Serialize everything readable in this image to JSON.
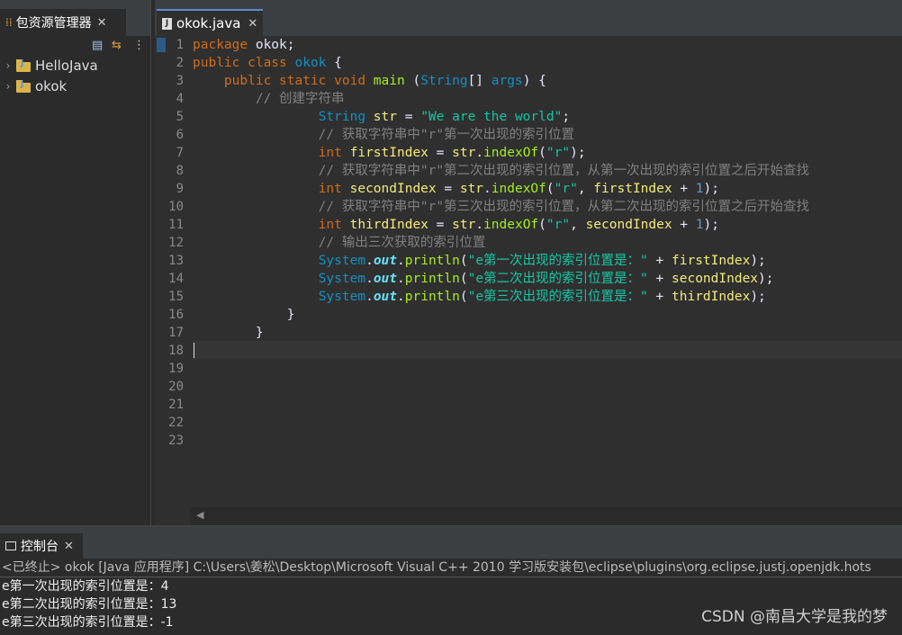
{
  "package_explorer": {
    "tab_label": "包资源管理器",
    "close_glyph": "✕",
    "items": [
      {
        "label": "HelloJava",
        "expanded": false
      },
      {
        "label": "okok",
        "expanded": false
      }
    ]
  },
  "editor": {
    "tab_label": "okok.java",
    "close_glyph": "✕",
    "line_numbers": [
      "1",
      "2",
      "3",
      "4",
      "5",
      "6",
      "7",
      "8",
      "9",
      "10",
      "11",
      "12",
      "13",
      "14",
      "15",
      "16",
      "17",
      "18",
      "19",
      "20",
      "21",
      "22",
      "23"
    ],
    "code_lines": [
      [
        {
          "t": "package ",
          "c": "kw"
        },
        {
          "t": "okok;",
          "c": "op"
        }
      ],
      [
        {
          "t": "public ",
          "c": "kw"
        },
        {
          "t": "class ",
          "c": "kw"
        },
        {
          "t": "okok ",
          "c": "ty"
        },
        {
          "t": "{",
          "c": "op"
        }
      ],
      [
        {
          "t": "    public ",
          "c": "kw"
        },
        {
          "t": "static ",
          "c": "kw"
        },
        {
          "t": "void ",
          "c": "kw"
        },
        {
          "t": "main ",
          "c": "mth"
        },
        {
          "t": "(",
          "c": "op"
        },
        {
          "t": "String",
          "c": "ty"
        },
        {
          "t": "[] ",
          "c": "op"
        },
        {
          "t": "args",
          "c": "ty"
        },
        {
          "t": ") {",
          "c": "op"
        }
      ],
      [
        {
          "t": "        // 创建字符串",
          "c": "cm"
        }
      ],
      [
        {
          "t": "                ",
          "c": "op"
        },
        {
          "t": "String ",
          "c": "ty"
        },
        {
          "t": "str ",
          "c": "var"
        },
        {
          "t": "= ",
          "c": "op"
        },
        {
          "t": "\"We are the world\"",
          "c": "str"
        },
        {
          "t": ";",
          "c": "op"
        }
      ],
      [
        {
          "t": "                // 获取字符串中\"r\"第一次出现的索引位置",
          "c": "cm"
        }
      ],
      [
        {
          "t": "                ",
          "c": "op"
        },
        {
          "t": "int ",
          "c": "kw"
        },
        {
          "t": "firstIndex ",
          "c": "var"
        },
        {
          "t": "= ",
          "c": "op"
        },
        {
          "t": "str",
          "c": "var"
        },
        {
          "t": ".",
          "c": "op"
        },
        {
          "t": "indexOf",
          "c": "mth"
        },
        {
          "t": "(",
          "c": "op"
        },
        {
          "t": "\"r\"",
          "c": "str"
        },
        {
          "t": ");",
          "c": "op"
        }
      ],
      [
        {
          "t": "                // 获取字符串中\"r\"第二次出现的索引位置，从第一次出现的索引位置之后开始查找",
          "c": "cm"
        }
      ],
      [
        {
          "t": "                ",
          "c": "op"
        },
        {
          "t": "int ",
          "c": "kw"
        },
        {
          "t": "secondIndex ",
          "c": "var"
        },
        {
          "t": "= ",
          "c": "op"
        },
        {
          "t": "str",
          "c": "var"
        },
        {
          "t": ".",
          "c": "op"
        },
        {
          "t": "indexOf",
          "c": "mth"
        },
        {
          "t": "(",
          "c": "op"
        },
        {
          "t": "\"r\"",
          "c": "str"
        },
        {
          "t": ", ",
          "c": "op"
        },
        {
          "t": "firstIndex ",
          "c": "var"
        },
        {
          "t": "+ ",
          "c": "op"
        },
        {
          "t": "1",
          "c": "num"
        },
        {
          "t": ");",
          "c": "op"
        }
      ],
      [
        {
          "t": "                // 获取字符串中\"r\"第三次出现的索引位置，从第二次出现的索引位置之后开始查找",
          "c": "cm"
        }
      ],
      [
        {
          "t": "                ",
          "c": "op"
        },
        {
          "t": "int ",
          "c": "kw"
        },
        {
          "t": "thirdIndex ",
          "c": "var"
        },
        {
          "t": "= ",
          "c": "op"
        },
        {
          "t": "str",
          "c": "var"
        },
        {
          "t": ".",
          "c": "op"
        },
        {
          "t": "indexOf",
          "c": "mth"
        },
        {
          "t": "(",
          "c": "op"
        },
        {
          "t": "\"r\"",
          "c": "str"
        },
        {
          "t": ", ",
          "c": "op"
        },
        {
          "t": "secondIndex ",
          "c": "var"
        },
        {
          "t": "+ ",
          "c": "op"
        },
        {
          "t": "1",
          "c": "num"
        },
        {
          "t": ");",
          "c": "op"
        }
      ],
      [
        {
          "t": "                // 输出三次获取的索引位置",
          "c": "cm"
        }
      ],
      [
        {
          "t": "                ",
          "c": "op"
        },
        {
          "t": "System",
          "c": "ty"
        },
        {
          "t": ".",
          "c": "op"
        },
        {
          "t": "out",
          "c": "fld"
        },
        {
          "t": ".",
          "c": "op"
        },
        {
          "t": "println",
          "c": "mth"
        },
        {
          "t": "(",
          "c": "op"
        },
        {
          "t": "\"e第一次出现的索引位置是：\"",
          "c": "str"
        },
        {
          "t": " + ",
          "c": "op"
        },
        {
          "t": "firstIndex",
          "c": "var"
        },
        {
          "t": ");",
          "c": "op"
        }
      ],
      [
        {
          "t": "                ",
          "c": "op"
        },
        {
          "t": "System",
          "c": "ty"
        },
        {
          "t": ".",
          "c": "op"
        },
        {
          "t": "out",
          "c": "fld"
        },
        {
          "t": ".",
          "c": "op"
        },
        {
          "t": "println",
          "c": "mth"
        },
        {
          "t": "(",
          "c": "op"
        },
        {
          "t": "\"e第二次出现的索引位置是：\"",
          "c": "str"
        },
        {
          "t": " + ",
          "c": "op"
        },
        {
          "t": "secondIndex",
          "c": "var"
        },
        {
          "t": ");",
          "c": "op"
        }
      ],
      [
        {
          "t": "                ",
          "c": "op"
        },
        {
          "t": "System",
          "c": "ty"
        },
        {
          "t": ".",
          "c": "op"
        },
        {
          "t": "out",
          "c": "fld"
        },
        {
          "t": ".",
          "c": "op"
        },
        {
          "t": "println",
          "c": "mth"
        },
        {
          "t": "(",
          "c": "op"
        },
        {
          "t": "\"e第三次出现的索引位置是：\"",
          "c": "str"
        },
        {
          "t": " + ",
          "c": "op"
        },
        {
          "t": "thirdIndex",
          "c": "var"
        },
        {
          "t": ");",
          "c": "op"
        }
      ],
      [
        {
          "t": "            }",
          "c": "op"
        }
      ],
      [
        {
          "t": "        }",
          "c": "op"
        }
      ],
      [],
      [],
      [],
      [],
      [],
      []
    ]
  },
  "console": {
    "tab_label": "控制台",
    "close_glyph": "✕",
    "header": "<已终止> okok [Java 应用程序] C:\\Users\\姜松\\Desktop\\Microsoft Visual C++ 2010 学习版安装包\\eclipse\\plugins\\org.eclipse.justj.openjdk.hots",
    "output": [
      "e第一次出现的索引位置是：4",
      "e第二次出现的索引位置是：13",
      "e第三次出现的索引位置是：-1"
    ]
  },
  "watermark": "CSDN @南昌大学是我的梦",
  "colors": {
    "keyword": "#cc6c1d",
    "type": "#1290c3",
    "string": "#17c6a3",
    "comment": "#808080",
    "method": "#a7ec21",
    "variable": "#f3ec79",
    "field": "#66e1f8",
    "number": "#6897bb"
  }
}
